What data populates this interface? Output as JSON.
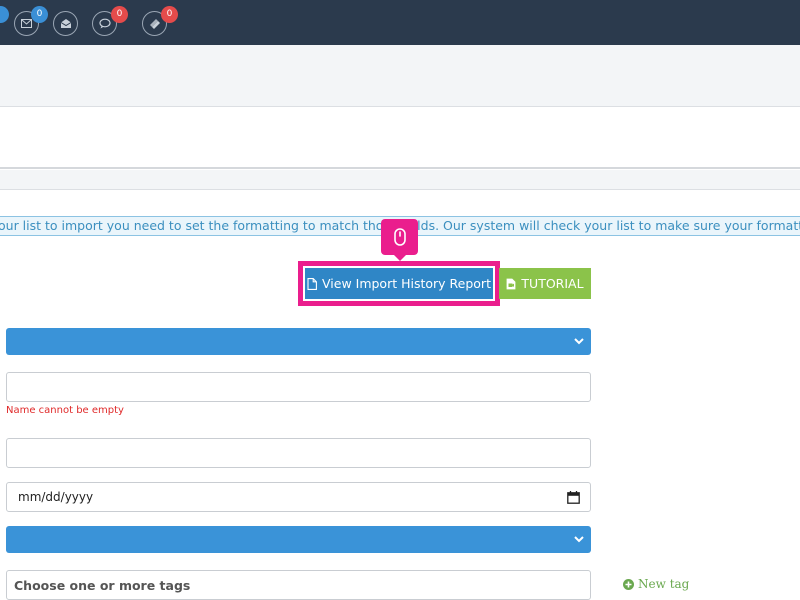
{
  "topbar": {
    "badges": [
      {
        "icon": "mail-icon",
        "count": "0",
        "color": "#3a8fd6"
      },
      {
        "icon": "envelope-open-icon",
        "count": ""
      },
      {
        "icon": "chat-bubble-icon",
        "count": "0",
        "color": "#e54b4b"
      },
      {
        "icon": "ticket-icon",
        "count": "0",
        "color": "#e54b4b"
      }
    ]
  },
  "info_text": "our list to import you need to set the formatting to match those fields.  Our system will check your list to make sure your formatting is correct",
  "tooltip": {
    "icon": "mouse-icon"
  },
  "buttons": {
    "history_label": "View Import History Report",
    "tutorial_label": "TUTORIAL"
  },
  "form": {
    "name_error": "Name cannot be empty",
    "date_placeholder": "mm/dd/yyyy",
    "tags_placeholder": "Choose one or more tags",
    "new_tag_label": "New tag"
  },
  "colors": {
    "topbar": "#2b3a4d",
    "primary": "#2f86c6",
    "select_blue": "#3a93d8",
    "success": "#8bc34a",
    "highlight": "#ea1e8d",
    "error": "#e02a2a"
  }
}
